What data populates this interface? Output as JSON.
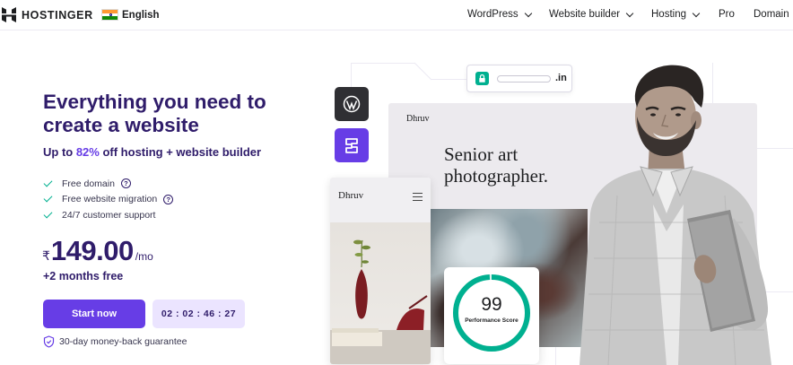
{
  "brand": {
    "name": "HOSTINGER"
  },
  "language": {
    "label": "English",
    "flag": "india-flag"
  },
  "nav": {
    "items": [
      {
        "label": "WordPress",
        "dropdown": true
      },
      {
        "label": "Website builder",
        "dropdown": true
      },
      {
        "label": "Hosting",
        "dropdown": true
      },
      {
        "label": "Pro",
        "dropdown": false
      },
      {
        "label": "Domain",
        "dropdown": false
      }
    ]
  },
  "hero": {
    "title": "Everything you need to create a website",
    "subtitle_prefix": "Up to ",
    "subtitle_percent": "82%",
    "subtitle_suffix": " off hosting + website builder",
    "features": [
      {
        "label": "Free domain",
        "help": true
      },
      {
        "label": "Free website migration",
        "help": true
      },
      {
        "label": "24/7 customer support",
        "help": false
      }
    ],
    "price": {
      "currency": "₹",
      "amount": "149.00",
      "period": "/mo"
    },
    "bonus": "+2 months free",
    "cta_label": "Start now",
    "timer": "02 : 02 : 46 : 27",
    "guarantee": "30-day money-back guarantee"
  },
  "visual": {
    "domain_tld": ".in",
    "desktop_site": {
      "brand": "Dhruv",
      "headline": "Senior art photographer."
    },
    "mobile_site": {
      "brand": "Dhruv"
    },
    "performance": {
      "score": "99",
      "label": "Performance Score"
    },
    "icons": [
      "wordpress-icon",
      "hostinger-builder-icon",
      "lock-icon",
      "menu-icon",
      "shield-check-icon"
    ]
  },
  "colors": {
    "brand_purple": "#673de6",
    "navy_text": "#2f1c6a",
    "accent_green": "#00b090",
    "timer_bg": "#ebe4ff"
  }
}
